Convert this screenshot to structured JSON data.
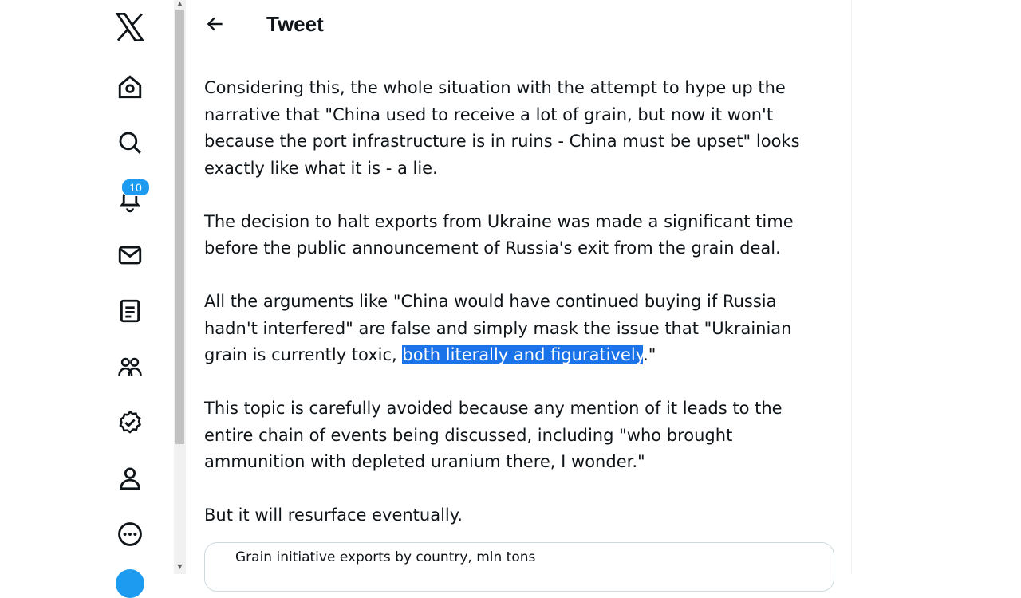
{
  "header": {
    "title": "Tweet"
  },
  "sidebar": {
    "notification_count": "10"
  },
  "tweet": {
    "paragraphs": [
      "Considering this, the whole situation with the attempt to hype up the\nnarrative that \"China used to receive a lot of grain, but now it won't\nbecause the port infrastructure is in ruins - China must be upset\" looks\nexactly like what it is - a lie.",
      "The decision to halt exports from Ukraine was made a significant time\nbefore the public announcement of Russia's exit from the grain deal.",
      "This topic is carefully avoided because any mention of it leads to the\nentire chain of events being discussed, including \"who brought\nammunition with depleted uranium there, I wonder.\"",
      "But it will resurface eventually."
    ],
    "p3_before": "All the arguments like \"China would have continued buying if Russia\nhadn't interfered\" are false and simply mask the issue that \"Ukrainian\ngrain is currently toxic, ",
    "p3_highlight": "both literally and figuratively",
    "p3_after": ".\"",
    "card_title": "Grain initiative exports by country, mln tons"
  },
  "colors": {
    "accent": "#1d9bf0",
    "selection": "#1a73e8"
  }
}
